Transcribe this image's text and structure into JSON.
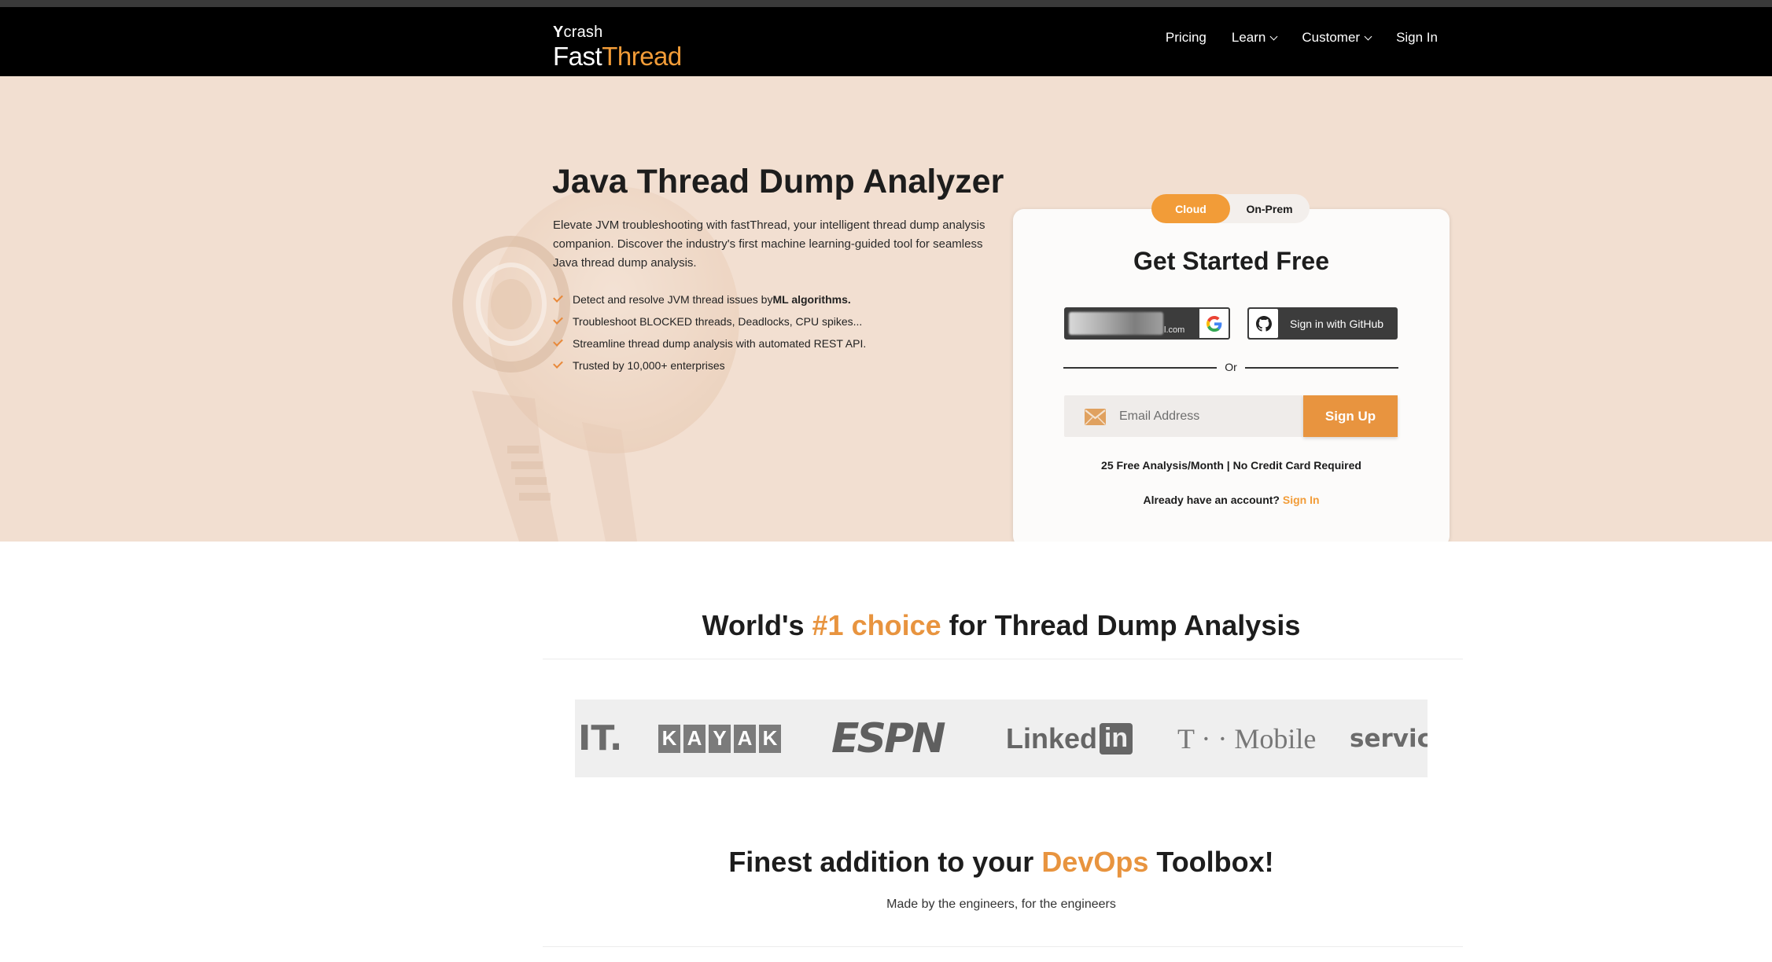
{
  "brand": {
    "prefix": "crash",
    "prefix_mark": "Y",
    "name_part1": "Fast",
    "name_part2": "Thread"
  },
  "nav": {
    "items": [
      {
        "label": "Pricing",
        "dropdown": false
      },
      {
        "label": "Learn",
        "dropdown": true
      },
      {
        "label": "Customer",
        "dropdown": true
      },
      {
        "label": "Sign In",
        "dropdown": false
      }
    ]
  },
  "hero": {
    "title": "Java Thread Dump Analyzer",
    "description": "Elevate JVM troubleshooting with fastThread, your intelligent thread dump analysis companion. Discover the industry's first machine learning-guided tool for seamless Java thread dump analysis.",
    "features": [
      {
        "text": "Detect and resolve JVM thread issues by ",
        "bold": "ML algorithms."
      },
      {
        "text": "Troubleshoot BLOCKED threads, Deadlocks, CPU spikes...",
        "bold": ""
      },
      {
        "text": "Streamline thread dump analysis with automated REST API.",
        "bold": ""
      },
      {
        "text": "Trusted by 10,000+ enterprises",
        "bold": ""
      }
    ]
  },
  "signup": {
    "toggle": {
      "cloud": "Cloud",
      "onprem": "On-Prem",
      "active": "cloud"
    },
    "title": "Get Started Free",
    "google_account_fragment": "l.com",
    "github_label": "Sign in with GitHub",
    "or_text": "Or",
    "email_placeholder": "Email Address",
    "signup_label": "Sign Up",
    "free_note": "25 Free Analysis/Month | No Credit Card Required",
    "account_prompt": "Already have an account?",
    "signin_link": "Sign In"
  },
  "choice": {
    "title_pre": "World's ",
    "title_highlight": "#1 choice",
    "title_post": " for Thread Dump Analysis",
    "logos": {
      "it": "IT.",
      "kayak": [
        "K",
        "A",
        "Y",
        "A",
        "K"
      ],
      "espn": "ESPN",
      "linkedin_text": "Linked",
      "linkedin_box": "in",
      "tmobile": "T · · Mobile",
      "service": "service"
    }
  },
  "devops": {
    "title_pre": "Finest addition to your ",
    "title_highlight": "DevOps",
    "title_post": " Toolbox!",
    "subtitle": "Made by the engineers, for the engineers"
  },
  "colors": {
    "accent": "#f29c38",
    "button": "#e8943f",
    "hero_bg": "#f2dfd1",
    "nav_bg": "#000000"
  }
}
